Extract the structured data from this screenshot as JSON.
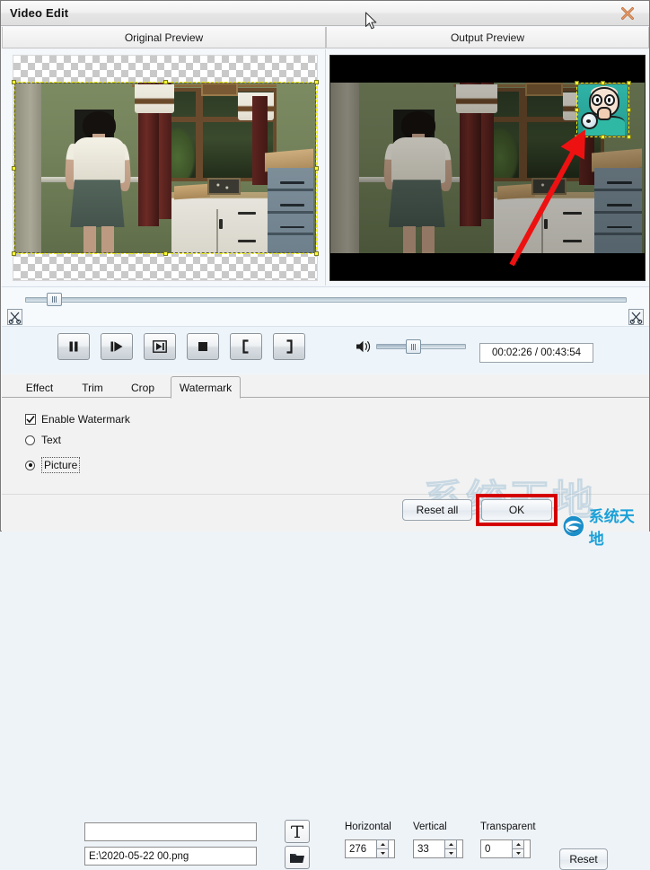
{
  "window": {
    "title": "Video Edit",
    "close_icon": "close-x-icon"
  },
  "preview": {
    "left_header": "Original Preview",
    "right_header": "Output Preview"
  },
  "timeline": {
    "cut_left_icon": "scissors-icon",
    "cut_right_icon": "scissors-icon"
  },
  "transport": {
    "buttons": [
      {
        "name": "pause-button",
        "icon": "pause-icon"
      },
      {
        "name": "play-button",
        "icon": "play-icon"
      },
      {
        "name": "next-frame-button",
        "icon": "step-forward-icon"
      },
      {
        "name": "stop-button",
        "icon": "stop-icon"
      },
      {
        "name": "mark-in-button",
        "icon": "bracket-left-icon"
      },
      {
        "name": "mark-out-button",
        "icon": "bracket-right-icon"
      }
    ],
    "volume_icon": "speaker-icon",
    "time_display": "00:02:26 / 00:43:54"
  },
  "tabs": [
    {
      "label": "Effect",
      "active": false
    },
    {
      "label": "Trim",
      "active": false
    },
    {
      "label": "Crop",
      "active": false
    },
    {
      "label": "Watermark",
      "active": true
    }
  ],
  "watermark_panel": {
    "enable_label": "Enable Watermark",
    "enable_checked": true,
    "text_radio_label": "Text",
    "text_value": "",
    "text_placeholder": "",
    "picture_radio_label": "Picture",
    "picture_value": "E:\\2020-05-22 00.png",
    "selected_source": "Picture",
    "font_button_icon": "font-T-icon",
    "browse_button_icon": "folder-icon",
    "fields": [
      {
        "label": "Horizontal",
        "value": "276"
      },
      {
        "label": "Vertical",
        "value": "33"
      },
      {
        "label": "Transparent",
        "value": "0"
      }
    ],
    "reset_label": "Reset"
  },
  "footer": {
    "reset_all_label": "Reset all",
    "ok_label": "OK",
    "highlight_color": "#d40000"
  },
  "branding": {
    "logo_text": "系统天地",
    "bg_watermark_text": "系统天地",
    "logo_color": "#1aa0d8"
  }
}
